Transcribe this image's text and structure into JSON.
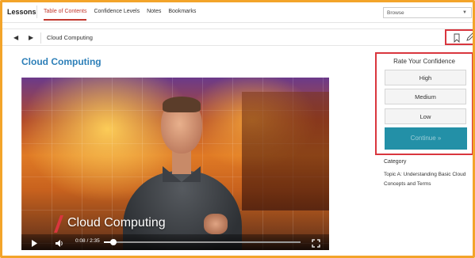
{
  "nav": {
    "lessons_label": "Lessons",
    "tabs": [
      {
        "label": "Table of Contents",
        "active": true
      },
      {
        "label": "Confidence Levels",
        "active": false
      },
      {
        "label": "Notes",
        "active": false
      },
      {
        "label": "Bookmarks",
        "active": false
      }
    ],
    "browse_label": "Browse"
  },
  "breadcrumb": {
    "title": "Cloud Computing"
  },
  "page": {
    "title": "Cloud Computing"
  },
  "video": {
    "overlay_title": "Cloud Computing",
    "time_display": "0:08 / 2:35",
    "progress_fraction": 0.05
  },
  "confidence": {
    "title": "Rate Your Confidence",
    "options": [
      "High",
      "Medium",
      "Low"
    ],
    "continue_label": "Continue »"
  },
  "sidebar": {
    "category_label": "Category",
    "topic": "Topic A: Understanding Basic Cloud Concepts and Terms"
  },
  "colors": {
    "accent_red": "#c2372c",
    "title_blue": "#2d7fb8",
    "continue_teal": "#2390a7",
    "highlight_orange": "#f3a42a"
  }
}
